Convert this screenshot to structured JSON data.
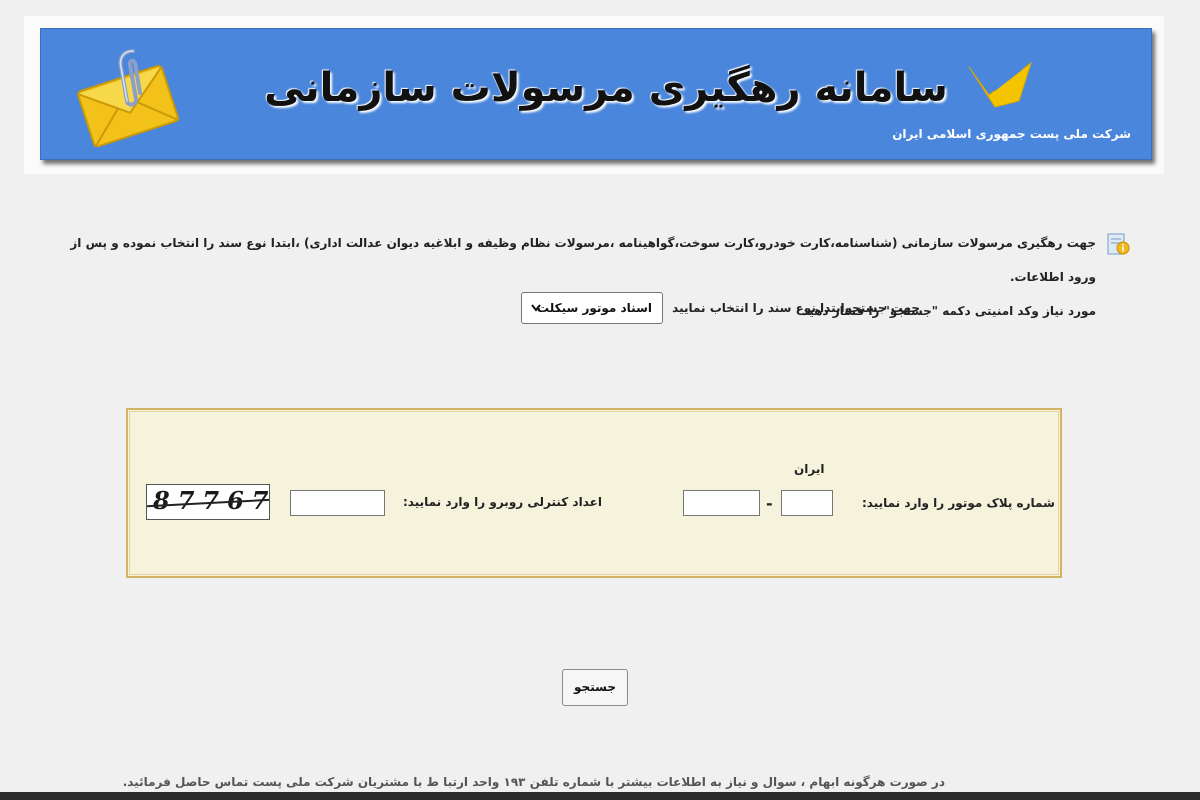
{
  "header": {
    "title": "سامانه رهگیری مرسولات سازمانی",
    "company_name": "شرکت ملی پست جمهوری اسلامی ایران",
    "post_logo_icon": "post-logo-icon",
    "envelope_icon": "envelope-icon"
  },
  "info": {
    "icon": "info-icon",
    "line1": "جهت رهگیری مرسولات سازمانی (شناسنامه،کارت خودرو،کارت سوخت،گواهینامه ،مرسولات نظام وظیفه  و ابلاغیه دیوان عدالت اداری) ،ابتدا  نوع سند را انتخاب نموده و پس از ورود اطلاعات.",
    "line2": "مورد نیاز وکد امنیتی دکمه \"جستجو\" را فشار دهید"
  },
  "doc_type": {
    "label": "جهت جستجوابتدا نوع سند را انتخاب نمایید",
    "selected": "اسناد موتور سیکلت",
    "chevron_icon": "chevron-down-icon"
  },
  "form": {
    "iran_label": "ایران",
    "plate_label": "شماره پلاک موتور را وارد نمایید:",
    "plate_dash": "-",
    "plate_part1_value": "",
    "plate_part2_value": "",
    "captcha_label": "اعداد کنترلی روبرو را وارد نمایید:",
    "captcha_input_value": "",
    "captcha_text": "87767"
  },
  "actions": {
    "search_label": "جستجو"
  },
  "footer": {
    "text": "در صورت هرگونه ابهام ، سوال و نیاز به اطلاعات بیشتر با شماره تلفن ۱۹۳ واحد ارتبا ط با مشتریان شرکت ملی پست تماس حاصل فرمائید."
  },
  "colors": {
    "banner": "#4a86db",
    "form_background": "#f5f3dc",
    "form_border": "#d4b263",
    "logo_yellow": "#f5c400"
  }
}
